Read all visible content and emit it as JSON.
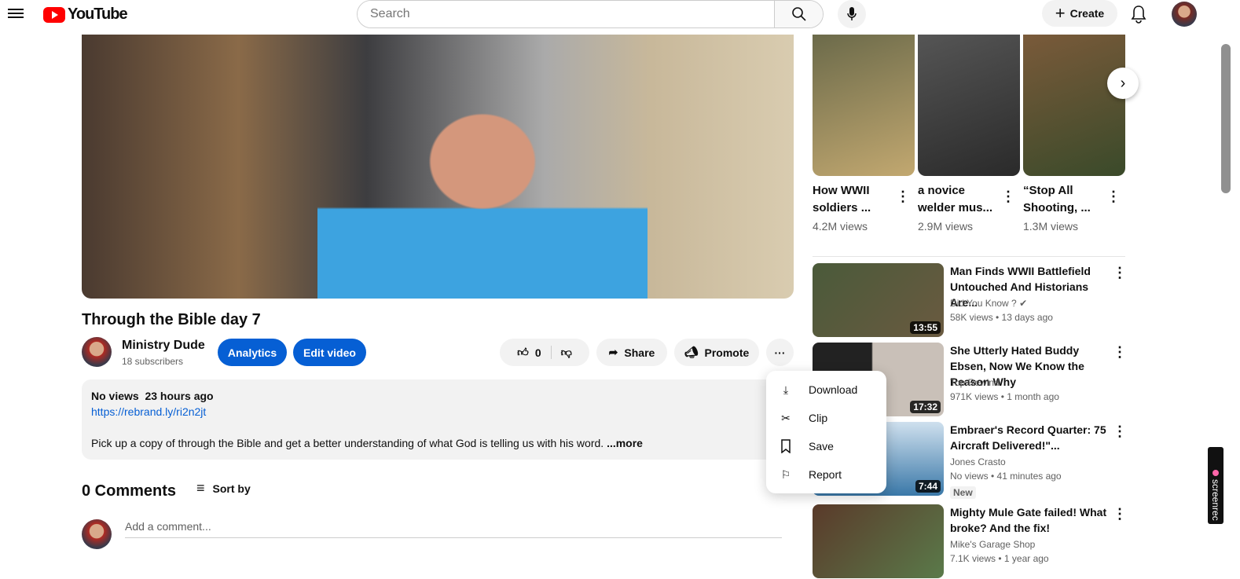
{
  "header": {
    "logo": "YouTube",
    "search_placeholder": "Search",
    "create": "Create"
  },
  "video": {
    "title": "Through the Bible day 7"
  },
  "channel": {
    "name": "Ministry Dude",
    "subs": "18 subscribers"
  },
  "actions": {
    "analytics": "Analytics",
    "edit": "Edit video",
    "likes": "0",
    "share": "Share",
    "promote": "Promote"
  },
  "description": {
    "meta": "No views  23 hours ago",
    "link": "https://rebrand.ly/ri2n2jt",
    "body": "Pick up a copy of through the Bible and get a better understanding of what God is telling us with his word. ",
    "more": "...more"
  },
  "comments": {
    "count": "0 Comments",
    "sort": "Sort by",
    "placeholder": "Add a comment..."
  },
  "menu": [
    {
      "label": "Download",
      "icon": "download-icon"
    },
    {
      "label": "Clip",
      "icon": "scissors-icon"
    },
    {
      "label": "Save",
      "icon": "bookmark-icon"
    },
    {
      "label": "Report",
      "icon": "flag-icon"
    }
  ],
  "shorts": [
    {
      "title": "How WWII soldiers ...",
      "views": "4.2M views"
    },
    {
      "title": "a novice welder mus...",
      "views": "2.9M views"
    },
    {
      "title": "“Stop All Shooting, ...",
      "views": "1.3M views"
    }
  ],
  "recs": [
    {
      "title": "Man Finds WWII Battlefield Untouched And Historians Are...",
      "channel": "Did You Know ? ✔",
      "views": "58K views • 13 days ago",
      "duration": "13:55"
    },
    {
      "title": "She Utterly Hated Buddy Ebsen, Now We Know the Reason Why",
      "channel": "Top Rewind",
      "views": "971K views • 1 month ago",
      "duration": "17:32"
    },
    {
      "title": "Embraer's Record Quarter: 75 Aircraft Delivered!\"...",
      "channel": "Jones Crasto",
      "views": "No views • 41 minutes ago",
      "duration": "7:44",
      "badge": "New"
    },
    {
      "title": "Mighty Mule Gate failed! What broke? And the fix!",
      "channel": "Mike's Garage Shop",
      "views": "7.1K views • 1 year ago"
    }
  ],
  "overlay": {
    "screenrec": "screenrec"
  }
}
